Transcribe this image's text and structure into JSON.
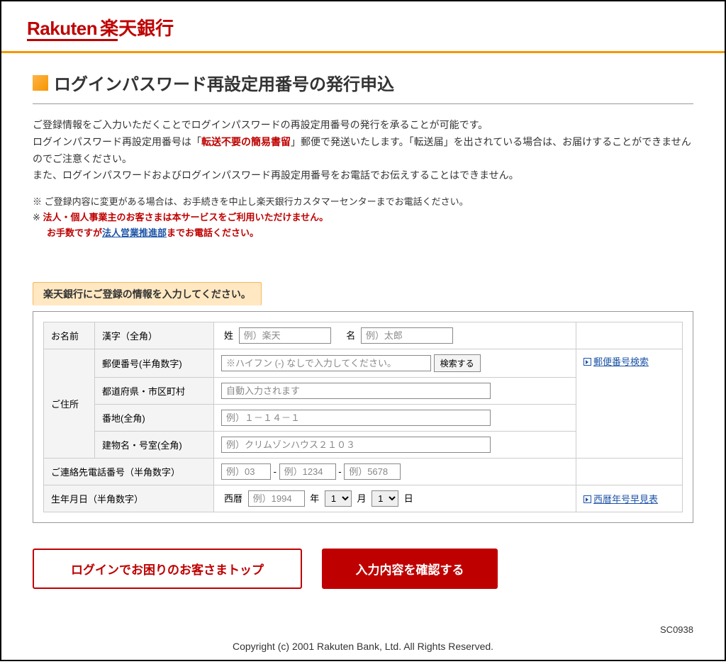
{
  "logo": {
    "brand": "Rakuten",
    "bank": "楽天銀行"
  },
  "page_title": "ログインパスワード再設定用番号の発行申込",
  "intro": {
    "line1": "ご登録情報をご入力いただくことでログインパスワードの再設定用番号の発行を承ることが可能です。",
    "line2a": "ログインパスワード再設定用番号は「",
    "line2red": "転送不要の簡易書留",
    "line2b": "」郵便で発送いたします。「転送届」を出されている場合は、お届けすることができませんのでご注意ください。",
    "line3": "また、ログインパスワードおよびログインパスワード再設定用番号をお電話でお伝えすることはできません。"
  },
  "notes": {
    "n1": "※ ご登録内容に変更がある場合は、お手続きを中止し楽天銀行カスタマーセンターまでお電話ください。",
    "n2prefix": "※ ",
    "n2red": "法人・個人事業主のお客さまは本サービスをご利用いただけません。",
    "n3a": "お手数ですが",
    "n3link": "法人営業推進部",
    "n3b": "までお電話ください。"
  },
  "form_section_label": "楽天銀行にご登録の情報を入力してください。",
  "form": {
    "name": {
      "group": "お名前",
      "label": "漢字（全角）",
      "sei_label": "姓",
      "sei_ph": "例）楽天",
      "mei_label": "名",
      "mei_ph": "例）太郎"
    },
    "address": {
      "group": "ご住所",
      "zip_label": "郵便番号(半角数字)",
      "zip_ph": "※ハイフン (-) なしで入力してください。",
      "search_btn": "検索する",
      "pref_label": "都道府県・市区町村",
      "pref_ph": "自動入力されます",
      "street_label": "番地(全角)",
      "street_ph": "例）１－１４－１",
      "bldg_label": "建物名・号室(全角)",
      "bldg_ph": "例）クリムゾンハウス２１０３",
      "side_link": "郵便番号検索"
    },
    "phone": {
      "label": "ご連絡先電話番号（半角数字）",
      "p1_ph": "例）03",
      "p2_ph": "例）1234",
      "p3_ph": "例）5678",
      "dash": "-"
    },
    "dob": {
      "label": "生年月日（半角数字）",
      "era": "西暦",
      "year_ph": "例）1994",
      "year_suffix": "年",
      "month_val": "1",
      "month_suffix": "月",
      "day_val": "1",
      "day_suffix": "日",
      "side_link": "西暦年号早見表"
    }
  },
  "buttons": {
    "back": "ログインでお困りのお客さまトップ",
    "confirm": "入力内容を確認する"
  },
  "footer_code": "SC0938",
  "copyright": "Copyright (c) 2001 Rakuten Bank, Ltd. All Rights Reserved."
}
